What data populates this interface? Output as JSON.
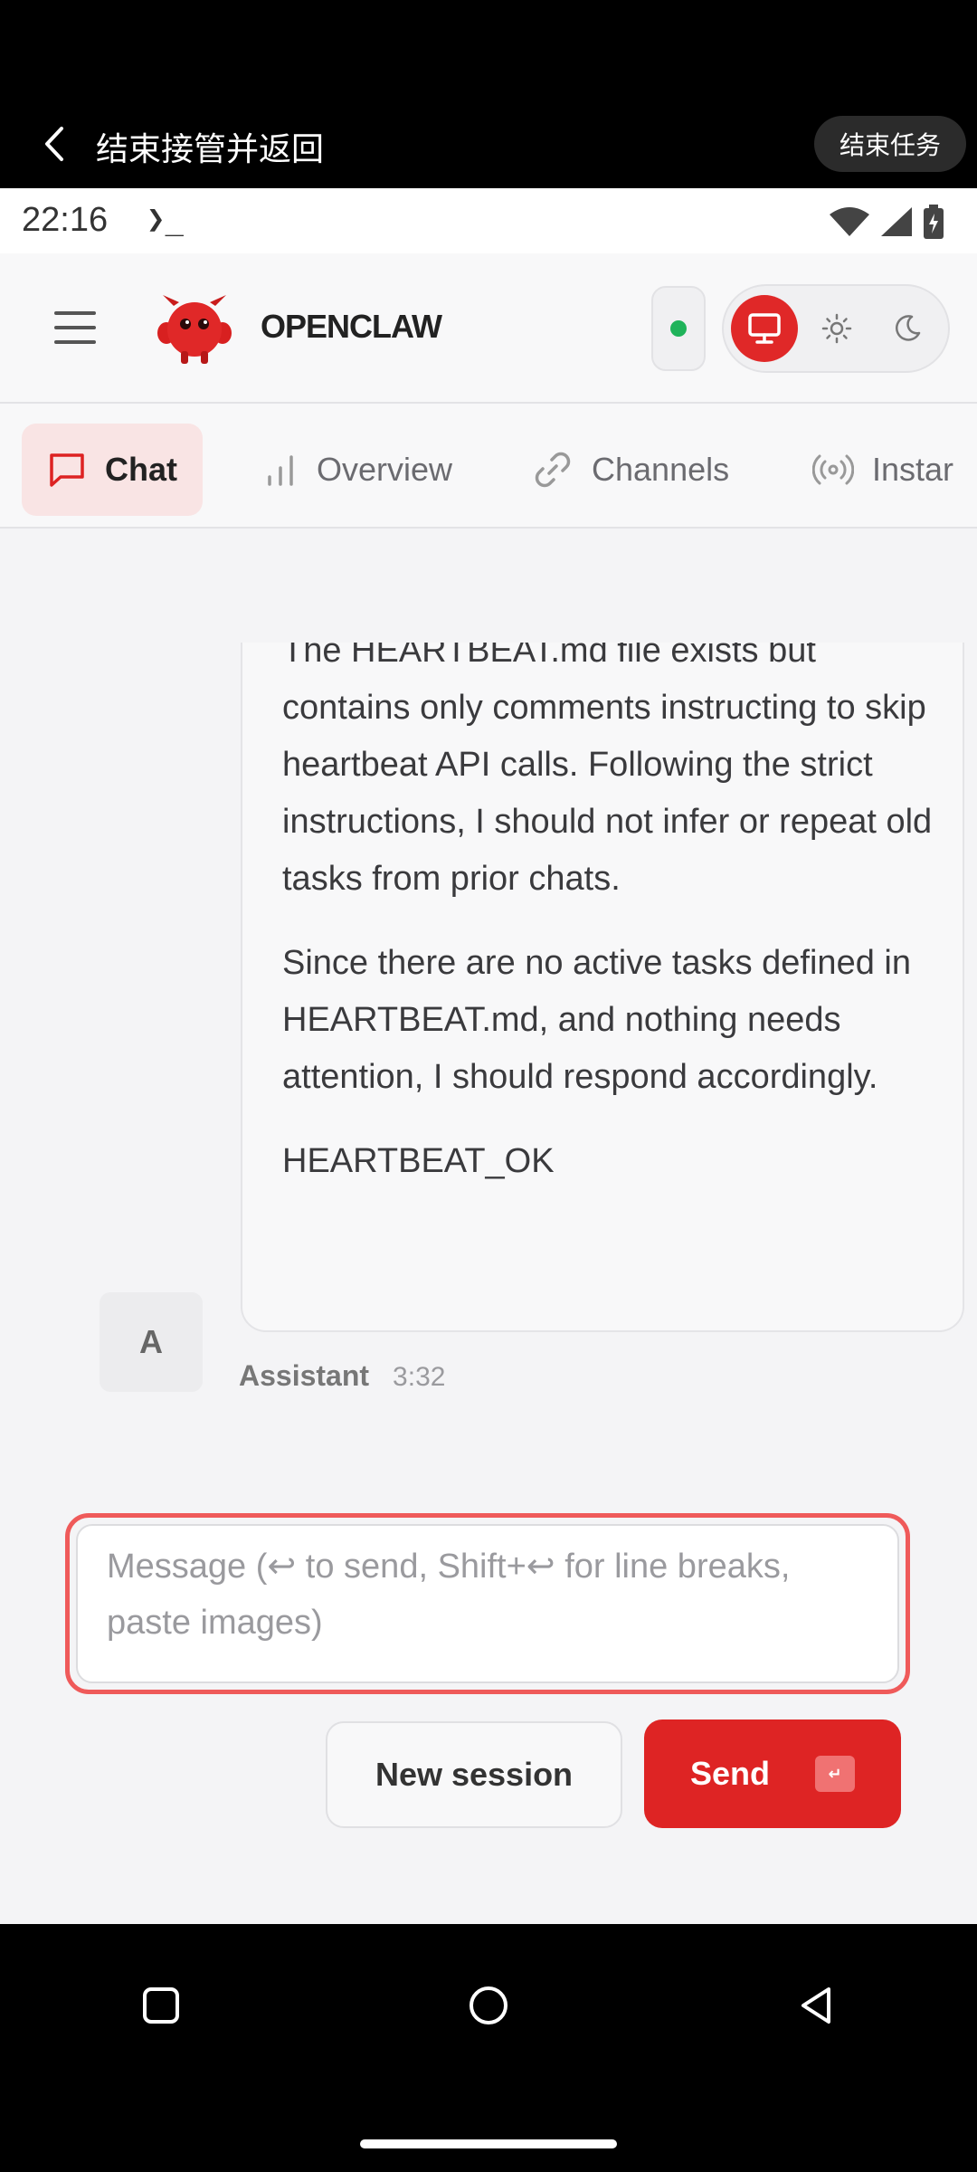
{
  "takeover": {
    "title": "结束接管并返回",
    "end_task": "结束任务"
  },
  "statusbar": {
    "time": "22:16",
    "terminal_glyph": "❯_"
  },
  "header": {
    "brand": "OPENCLAW",
    "connection_status_color": "#1fb35a",
    "accent": "#e02828"
  },
  "tabs": [
    {
      "label": "Chat",
      "icon": "chat-bubble-icon",
      "active": true
    },
    {
      "label": "Overview",
      "icon": "bar-chart-icon"
    },
    {
      "label": "Channels",
      "icon": "link-icon"
    },
    {
      "label": "Instar",
      "icon": "broadcast-icon"
    }
  ],
  "message": {
    "paragraphs": [
      "The HEARTBEAT.md file exists but contains only comments instructing to skip heartbeat API calls. Following the strict instructions, I should not infer or repeat old tasks from prior chats.",
      "Since there are no active tasks defined in HEARTBEAT.md, and nothing needs attention, I should respond accordingly.",
      "HEARTBEAT_OK"
    ],
    "avatar_letter": "A",
    "sender": "Assistant",
    "time": "3:32"
  },
  "composer": {
    "placeholder": "Message (↩ to send, Shift+↩ for line breaks, paste images)",
    "value": ""
  },
  "actions": {
    "new_session": "New session",
    "send": "Send",
    "send_kbd": "↵"
  }
}
